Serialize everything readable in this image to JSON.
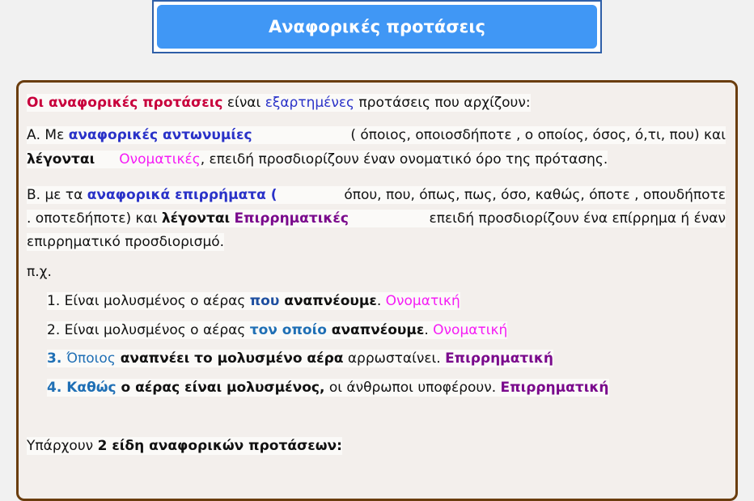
{
  "title": "Αναφορικές προτάσεις",
  "intro": {
    "term": "Οι αναφορικές προτάσεις",
    "t1": " είναι ",
    "dep": "εξαρτημένες",
    "t2": " προτάσεις που αρχίζουν:"
  },
  "a": {
    "lead": "Α. Με ",
    "pron": "αναφορικές αντωνυμίες",
    "list": " ( όποιος, οποιοσδήποτε , ο οποίος, όσος, ό,τι, που) και",
    "called": "λέγονται",
    "type": "Ονοματικές",
    "rest": ", επειδή προσδιορίζουν έναν ονοματικό όρο της πρότασης."
  },
  "b": {
    "lead": "Β. με τα ",
    "adv": "αναφορικά επιρρήματα (",
    "list": " όπου, που, όπως, πως, όσο, καθώς, όποτε , οπουδήποτε",
    "l2a": ". οποτεδήποτε) και ",
    "called": "λέγονται",
    "type": "Επιρρηματικές",
    "l2b": " επειδή  προσδιορίζουν ένα επίρρημα ή έναν",
    "l3": "επιρρηματικό προσδιορισμό."
  },
  "eg": "π.χ.",
  "examples": [
    {
      "num": "1. Είναι μολυσμένος ο αέρας ",
      "rel": "που",
      "verb": " αναπνέουμε",
      "punct": ". ",
      "type": "Ονοματική"
    },
    {
      "num": "2. Είναι μολυσμένος ο αέρας ",
      "rel": "τον οποίο",
      "verb": " αναπνέουμε",
      "punct": ". ",
      "type": "Ονοματική"
    },
    {
      "num": "3. ",
      "rel": "Όποιος",
      "verb": " αναπνέει το μολυσμένο αέρα",
      "rest": " αρρωσταίνει.  ",
      "type": "Επιρρηματική"
    },
    {
      "num": "4. ",
      "rel": "Καθώς",
      "verb": " ο αέρας είναι μολυσμένος,",
      "rest": " οι άνθρωποι υποφέρουν.  ",
      "type": "Επιρρηματική"
    }
  ],
  "summary": {
    "t1": "Υπάρχουν ",
    "bold": "2 είδη αναφορικών προτάσεων",
    "t2": ":"
  },
  "colors": {
    "title_bg": "#4097f5",
    "card_border": "#6a3d0e",
    "term": "#c8003c",
    "pron": "#2a32c8",
    "nominal": "#f51cf5",
    "adverbial": "#7a0a8c"
  }
}
